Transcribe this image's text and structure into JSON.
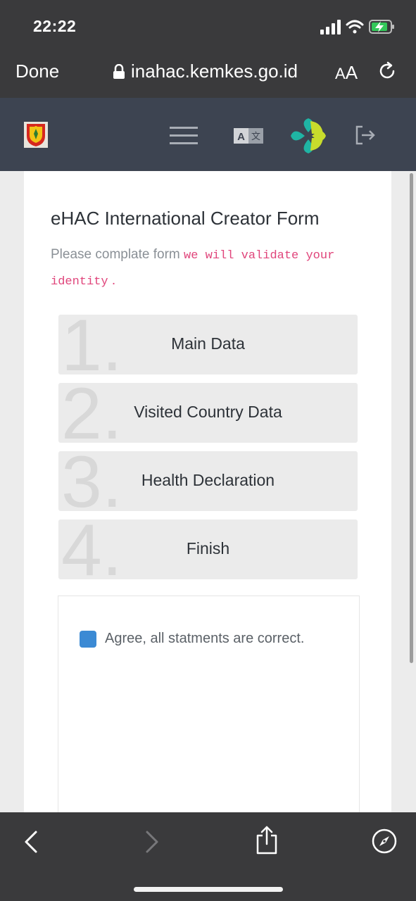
{
  "status_bar": {
    "time": "22:22"
  },
  "browser": {
    "done_label": "Done",
    "url": "inahac.kemkes.go.id",
    "text_size_label_small": "A",
    "text_size_label_big": "A"
  },
  "site_header": {
    "icons": [
      "logo-emblem",
      "hamburger-menu-icon",
      "translate-icon",
      "kemkes-logo",
      "logout-icon"
    ]
  },
  "form": {
    "title": "eHAC International Creator Form",
    "subtitle_plain": "Please complate form",
    "subtitle_code": "we will validate your identity",
    "subtitle_end": ".",
    "steps": [
      {
        "number": "1.",
        "label": "Main Data"
      },
      {
        "number": "2.",
        "label": "Visited Country Data"
      },
      {
        "number": "3.",
        "label": "Health Declaration"
      },
      {
        "number": "4.",
        "label": "Finish"
      }
    ],
    "agree_text": "Agree, all statments are correct."
  },
  "colors": {
    "browser_chrome": "#3a3a3c",
    "site_header": "#3d4451",
    "checkbox": "#3b8ad4",
    "code_text": "#e0457b"
  }
}
